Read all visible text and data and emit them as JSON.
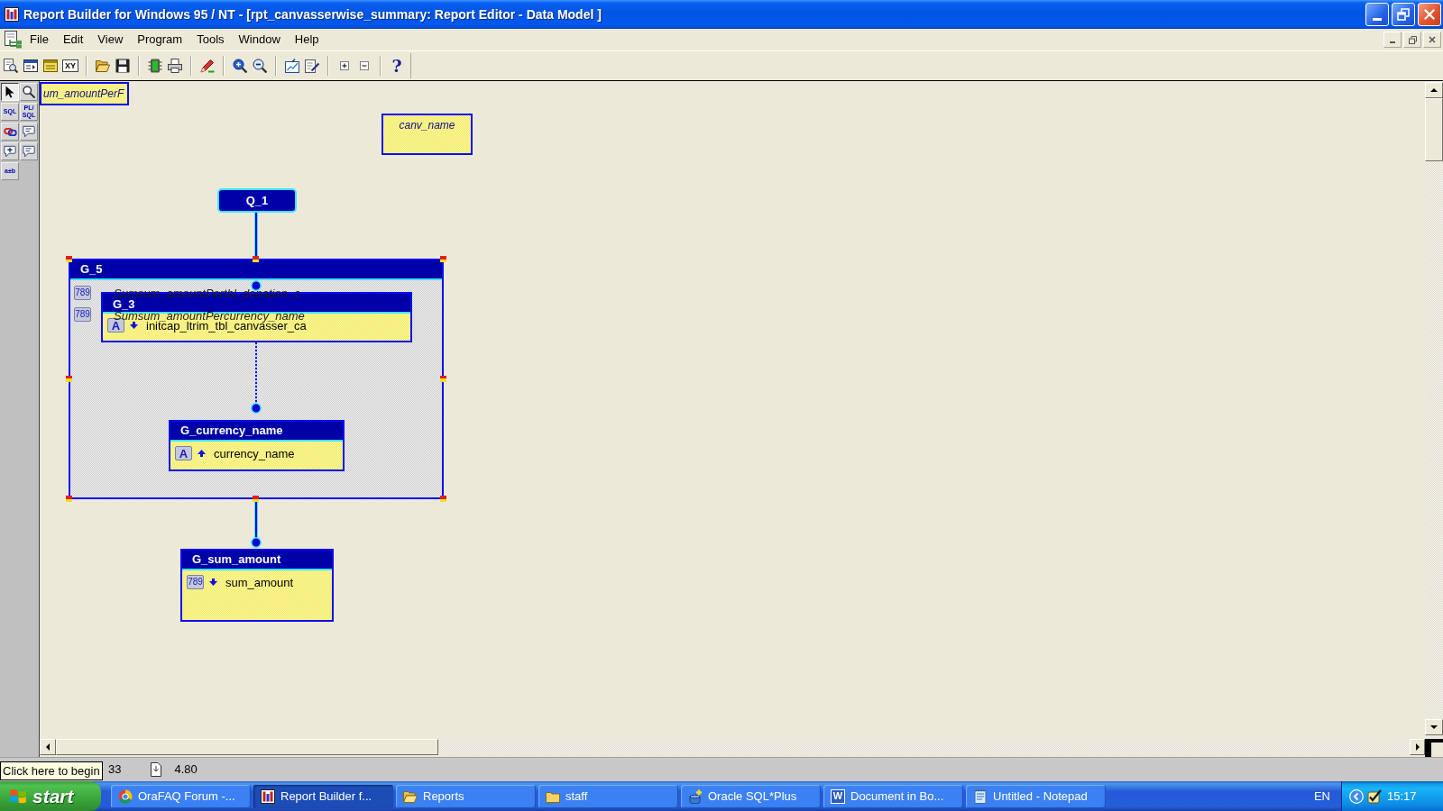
{
  "window": {
    "title": "Report Builder for Windows 95 / NT - [rpt_canvasserwise_summary: Report Editor - Data Model ]"
  },
  "menu_bar": {
    "items": [
      "File",
      "Edit",
      "View",
      "Program",
      "Tools",
      "Window",
      "Help"
    ]
  },
  "toolbar": {
    "xy_button": {
      "label": "XY"
    },
    "help_button": {
      "label": "?"
    }
  },
  "tool_palette": {
    "tools": [
      {
        "kind": "arrow",
        "selected": true
      },
      {
        "kind": "magnifier",
        "selected": false
      },
      {
        "kind": "label",
        "label": "SQL",
        "selected": false
      },
      {
        "kind": "label",
        "label": "PL/SQL",
        "selected": false
      },
      {
        "kind": "chain",
        "selected": false
      },
      {
        "kind": "bubble",
        "selected": false
      },
      {
        "kind": "bubble_plus",
        "selected": false
      },
      {
        "kind": "bubble",
        "selected": false
      },
      {
        "kind": "label",
        "label": "a±b",
        "selected": false
      }
    ]
  },
  "data_model": {
    "free_columns": [
      {
        "name": "um_amountPerF"
      },
      {
        "name": "canv_name"
      }
    ],
    "queries": [
      {
        "name": "Q_1"
      }
    ],
    "groups": [
      {
        "name": "G_5",
        "selected": true,
        "columns": [
          {
            "type_tag": "789",
            "name": "Sumsum_amountPertbl_donation_c"
          },
          {
            "type_tag": "789",
            "name": "Sumsum_amountPercurrency_name"
          }
        ],
        "children": [
          {
            "name": "G_3",
            "selected": false,
            "columns": [
              {
                "type_tag": "A",
                "arrow_up": false,
                "name": "initcap_ltrim_tbl_canvasser_ca"
              }
            ]
          },
          {
            "name": "G_currency_name",
            "selected": false,
            "columns": [
              {
                "type_tag": "A",
                "arrow_up": true,
                "name": "currency_name"
              }
            ]
          }
        ]
      },
      {
        "name": "G_sum_amount",
        "selected": false,
        "columns": [
          {
            "type_tag": "789",
            "arrow_up": false,
            "name": "sum_amount"
          }
        ]
      }
    ]
  },
  "status_bar": {
    "items": [
      {
        "kind": "plain",
        "text": "33"
      },
      {
        "kind": "page",
        "text": "4.80"
      }
    ]
  },
  "tooltip": {
    "text": "Click here to begin"
  },
  "taskbar": {
    "start_label": "start",
    "tasks": [
      {
        "kind": "logo",
        "label": "OraFAQ Forum -...",
        "selected": false
      },
      {
        "kind": "app",
        "label": "Report Builder f...",
        "selected": true
      },
      {
        "kind": "folder_open",
        "label": "Reports",
        "selected": false
      },
      {
        "kind": "folder",
        "label": "staff",
        "selected": false
      },
      {
        "kind": "database",
        "label": "Oracle SQL*Plus",
        "selected": false
      },
      {
        "kind": "letter",
        "badge": "W",
        "label": "Document in Bo...",
        "selected": false
      },
      {
        "kind": "notepad",
        "label": "Untitled - Notepad",
        "selected": false
      }
    ],
    "tray": {
      "language": "EN",
      "clock": "15:17"
    }
  }
}
